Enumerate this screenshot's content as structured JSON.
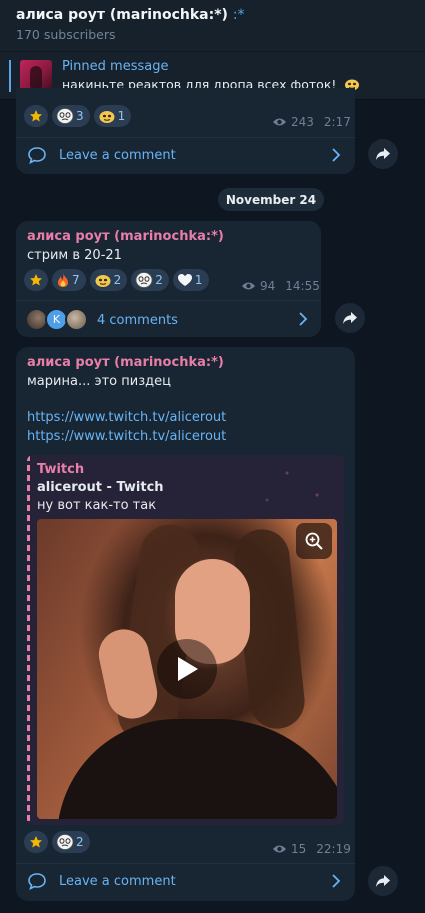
{
  "header": {
    "title": "алиса роут (marinochka:*)",
    "sparkle": ":*",
    "subscribers": "170 subscribers"
  },
  "pinned": {
    "label": "Pinned message",
    "text": "накиньте реактов для дропа всех фоток!"
  },
  "posts": [
    {
      "reactions": [
        {
          "icon": "star-icon",
          "count": ""
        },
        {
          "icon": "face-ghost-icon",
          "count": "3"
        },
        {
          "icon": "yellow-face-icon",
          "count": "1"
        }
      ],
      "views": "243",
      "time": "2:17",
      "comment_label": "Leave a comment"
    },
    {
      "author": "алиса роут (marinochka:*)",
      "text": "стрим в 20-21",
      "reactions": [
        {
          "icon": "star-icon",
          "count": ""
        },
        {
          "icon": "fire-icon",
          "count": "7"
        },
        {
          "icon": "yellow-face-icon",
          "count": "2"
        },
        {
          "icon": "face-ghost-icon",
          "count": "2"
        },
        {
          "icon": "white-heart-icon",
          "count": "1"
        }
      ],
      "views": "94",
      "time": "14:55",
      "comment_avatar_letter": "K",
      "comment_label": "4 comments"
    },
    {
      "author": "алиса роут (marinochka:*)",
      "text": "марина... это пиздец",
      "link1": "https://www.twitch.tv/alicerout",
      "link2": "https://www.twitch.tv/alicerout",
      "preview": {
        "site": "Twitch",
        "title": "alicerout - Twitch",
        "description": "ну вот как-то так"
      },
      "reactions": [
        {
          "icon": "star-icon",
          "count": ""
        },
        {
          "icon": "face-ghost-icon",
          "count": "2"
        }
      ],
      "views": "15",
      "time": "22:19",
      "comment_label": "Leave a comment"
    }
  ],
  "date_separator": "November 24",
  "colors": {
    "background": "#0e1621",
    "bubble": "#182533",
    "accent": "#6ab3f3",
    "author": "#e97ea8"
  }
}
